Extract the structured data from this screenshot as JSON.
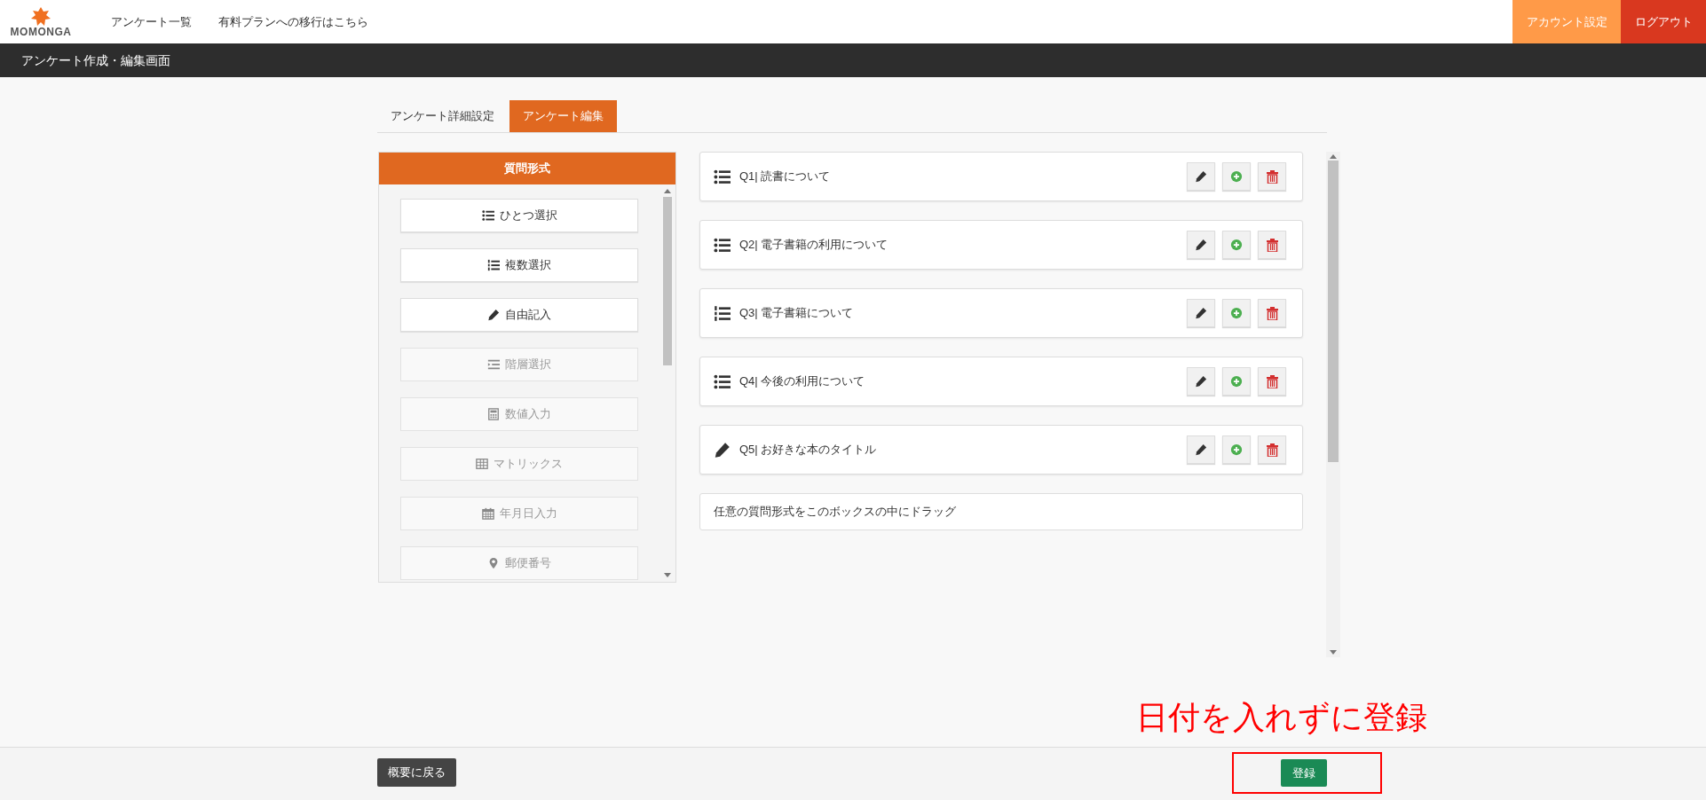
{
  "nav": {
    "logo": "MOMONGA",
    "links": [
      "アンケート一覧",
      "有料プランへの移行はこちら"
    ],
    "account_button": "アカウント設定",
    "logout_button": "ログアウト"
  },
  "page_title": "アンケート作成・編集画面",
  "tabs": [
    {
      "label": "アンケート詳細設定",
      "selected": false
    },
    {
      "label": "アンケート編集",
      "selected": true
    }
  ],
  "question_types": {
    "title": "質問形式",
    "items": [
      {
        "label": "ひとつ選択",
        "kind": "list",
        "disabled": false
      },
      {
        "label": "複数選択",
        "kind": "numbered",
        "disabled": false
      },
      {
        "label": "自由記入",
        "kind": "pencil",
        "disabled": false
      },
      {
        "label": "階層選択",
        "kind": "indent",
        "disabled": true
      },
      {
        "label": "数値入力",
        "kind": "calculator",
        "disabled": true
      },
      {
        "label": "マトリックス",
        "kind": "table",
        "disabled": true
      },
      {
        "label": "年月日入力",
        "kind": "calendar",
        "disabled": true
      },
      {
        "label": "郵便番号",
        "kind": "pin",
        "disabled": true
      }
    ]
  },
  "questions": [
    {
      "label": "Q1| 読書について",
      "kind": "list"
    },
    {
      "label": "Q2| 電子書籍の利用について",
      "kind": "list"
    },
    {
      "label": "Q3| 電子書籍について",
      "kind": "numbered"
    },
    {
      "label": "Q4| 今後の利用について",
      "kind": "list"
    },
    {
      "label": "Q5| お好きな本のタイトル",
      "kind": "pencil"
    }
  ],
  "drop_zone": "任意の質問形式をこのボックスの中にドラッグ",
  "footer": {
    "back_button": "概要に戻る",
    "register_button": "登録"
  },
  "annotation": "日付を入れずに登録"
}
